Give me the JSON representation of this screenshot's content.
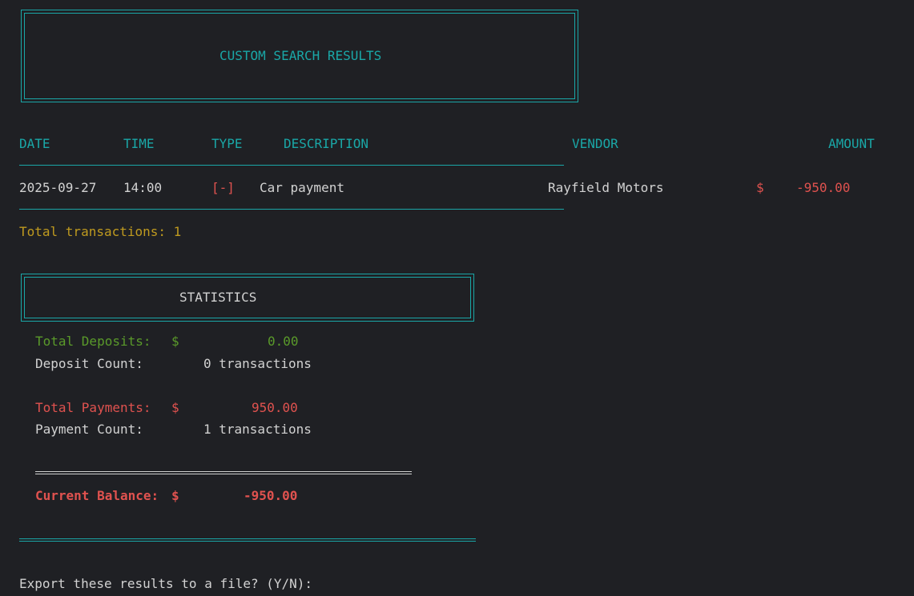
{
  "header": {
    "title": "CUSTOM SEARCH RESULTS"
  },
  "table": {
    "columns": {
      "date": "DATE",
      "time": "TIME",
      "type": "TYPE",
      "description": "DESCRIPTION",
      "vendor": "VENDOR",
      "amount": "AMOUNT"
    },
    "rows": [
      {
        "date": "2025-09-27",
        "time": "14:00",
        "type": "[-]",
        "description": "Car payment",
        "vendor": "Rayfield Motors",
        "currency": "$",
        "amount": "-950.00"
      }
    ],
    "total_label": "Total transactions: 1"
  },
  "statistics": {
    "title": "STATISTICS",
    "total_deposits_label": "Total Deposits:",
    "total_deposits_currency": "$",
    "total_deposits_value": "0.00",
    "deposit_count_label": "Deposit Count:",
    "deposit_count_value": "0 transactions",
    "total_payments_label": "Total Payments:",
    "total_payments_currency": "$",
    "total_payments_value": "950.00",
    "payment_count_label": "Payment Count:",
    "payment_count_value": "1 transactions",
    "current_balance_label": "Current Balance:",
    "current_balance_currency": "$",
    "current_balance_value": "-950.00"
  },
  "prompt": {
    "text": "Export these results to a file? (Y/N):"
  },
  "colors": {
    "background": "#1f2024",
    "accent": "#1aa7a7",
    "deposit": "#5a9a2a",
    "payment": "#e0524f",
    "info": "#bf9a1f"
  }
}
